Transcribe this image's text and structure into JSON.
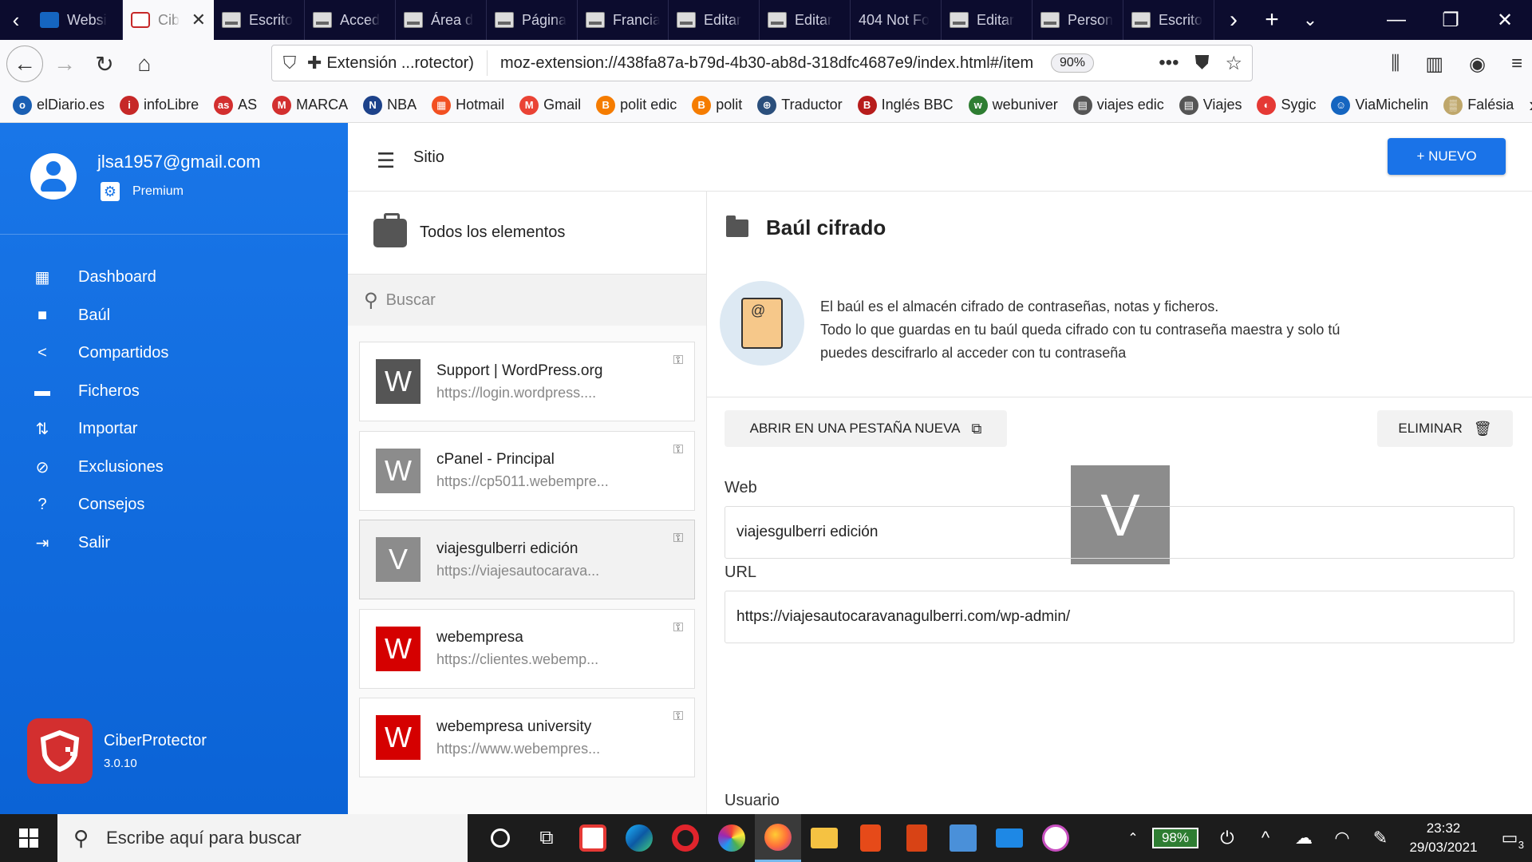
{
  "browser": {
    "tabs": [
      {
        "label": "Websi",
        "icon": "blue"
      },
      {
        "label": "Cib",
        "icon": "shield",
        "active": true
      },
      {
        "label": "Escrito",
        "icon": "doc"
      },
      {
        "label": "Acced",
        "icon": "doc"
      },
      {
        "label": "Área d",
        "icon": "doc"
      },
      {
        "label": "Página",
        "icon": "doc"
      },
      {
        "label": "Francia",
        "icon": "doc"
      },
      {
        "label": "Editar",
        "icon": "doc"
      },
      {
        "label": "Editar",
        "icon": "doc"
      },
      {
        "label": "404 Not Fo",
        "icon": "none"
      },
      {
        "label": "Editar",
        "icon": "doc"
      },
      {
        "label": "Person",
        "icon": "doc"
      },
      {
        "label": "Escrito",
        "icon": "doc"
      }
    ],
    "url_extension_label": "Extensión ...rotector)",
    "url": "moz-extension://438fa87a-b79d-4b30-ab8d-318dfc4687e9/index.html#/item",
    "zoom": "90%",
    "bookmarks": [
      {
        "label": "elDiario.es",
        "color": "#1a5fb4",
        "glyph": "o"
      },
      {
        "label": "infoLibre",
        "color": "#c62828",
        "glyph": "i"
      },
      {
        "label": "AS",
        "color": "#d32f2f",
        "glyph": "as"
      },
      {
        "label": "MARCA",
        "color": "#d32f2f",
        "glyph": "M"
      },
      {
        "label": "NBA",
        "color": "#1d428a",
        "glyph": "N"
      },
      {
        "label": "Hotmail",
        "color": "#f25022",
        "glyph": "▦"
      },
      {
        "label": "Gmail",
        "color": "#ea4335",
        "glyph": "M"
      },
      {
        "label": "polit edic",
        "color": "#f57c00",
        "glyph": "B"
      },
      {
        "label": "polit",
        "color": "#f57c00",
        "glyph": "B"
      },
      {
        "label": "Traductor",
        "color": "#2b4f7c",
        "glyph": "⊕"
      },
      {
        "label": "Inglés BBC",
        "color": "#b71c1c",
        "glyph": "B"
      },
      {
        "label": "webuniver",
        "color": "#2e7d32",
        "glyph": "w"
      },
      {
        "label": "viajes edic",
        "color": "#555555",
        "glyph": "▤"
      },
      {
        "label": "Viajes",
        "color": "#555555",
        "glyph": "▤"
      },
      {
        "label": "Sygic",
        "color": "#e53935",
        "glyph": "◐"
      },
      {
        "label": "ViaMichelin",
        "color": "#1565c0",
        "glyph": "☺"
      },
      {
        "label": "Falésia",
        "color": "#bfa76b",
        "glyph": "▒"
      }
    ]
  },
  "app": {
    "user_email": "jlsa1957@gmail.com",
    "plan": "Premium",
    "menu": [
      {
        "label": "Dashboard",
        "icon": "▦",
        "name": "dashboard"
      },
      {
        "label": "Baúl",
        "icon": "■",
        "name": "baul"
      },
      {
        "label": "Compartidos",
        "icon": "<",
        "name": "compartidos"
      },
      {
        "label": "Ficheros",
        "icon": "▬",
        "name": "ficheros"
      },
      {
        "label": "Importar",
        "icon": "⇅",
        "name": "importar"
      },
      {
        "label": "Exclusiones",
        "icon": "⊘",
        "name": "exclusiones"
      },
      {
        "label": "Consejos",
        "icon": "?",
        "name": "consejos"
      },
      {
        "label": "Salir",
        "icon": "⇥",
        "name": "salir"
      }
    ],
    "brand_name": "CiberProtector",
    "version": "3.0.10",
    "header_title": "Sitio",
    "new_button": "+ NUEVO",
    "list_title": "Todos los elementos",
    "search_placeholder": "Buscar",
    "items": [
      {
        "letter": "W",
        "name": "Support | WordPress.org",
        "url": "https://login.wordpress....",
        "color": "#555555"
      },
      {
        "letter": "W",
        "name": "cPanel - Principal",
        "url": "https://cp5011.webempre...",
        "color": "#8c8c8c"
      },
      {
        "letter": "V",
        "name": "viajesgulberri edición",
        "url": "https://viajesautocarava...",
        "color": "#8c8c8c",
        "selected": true
      },
      {
        "letter": "W",
        "name": "webempresa",
        "url": "https://clientes.webemp...",
        "color": "#d50000"
      },
      {
        "letter": "W",
        "name": "webempresa university",
        "url": "https://www.webempres...",
        "color": "#d50000"
      }
    ],
    "detail": {
      "title": "Baúl cifrado",
      "info_line1": "El baúl es el almacén cifrado de contraseñas, notas y ficheros.",
      "info_line2": "Todo lo que guardas en tu baúl queda cifrado con tu contraseña maestra y solo tú",
      "info_line3": "puedes descifrarlo al acceder con tu contraseña",
      "open_button": "ABRIR EN UNA PESTAÑA NUEVA",
      "delete_button": "ELIMINAR",
      "avatar_letter": "V",
      "web_label": "Web",
      "web_value": "viajesgulberri edición",
      "url_label": "URL",
      "url_value": "https://viajesautocaravanagulberri.com/wp-admin/",
      "user_label": "Usuario"
    }
  },
  "taskbar": {
    "search_placeholder": "Escribe aquí para buscar",
    "battery": "98%",
    "time": "23:32",
    "date": "29/03/2021",
    "notifications": "3"
  }
}
